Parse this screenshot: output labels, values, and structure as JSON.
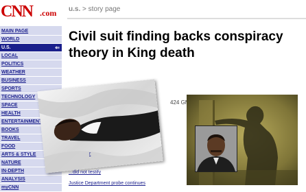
{
  "logo": {
    "text": "CNN",
    "suffix": ".com"
  },
  "nav": [
    {
      "label": "MAIN PAGE"
    },
    {
      "label": "WORLD"
    },
    {
      "label": "U.S.",
      "active": true
    },
    {
      "label": "LOCAL"
    },
    {
      "label": "POLITICS"
    },
    {
      "label": "WEATHER"
    },
    {
      "label": "BUSINESS"
    },
    {
      "label": "SPORTS"
    },
    {
      "label": "TECHNOLOGY"
    },
    {
      "label": "SPACE"
    },
    {
      "label": "HEALTH"
    },
    {
      "label": "ENTERTAINMENT"
    },
    {
      "label": "BOOKS"
    },
    {
      "label": "TRAVEL"
    },
    {
      "label": "FOOD"
    },
    {
      "label": "ARTS & STYLE"
    },
    {
      "label": "NATURE"
    },
    {
      "label": "IN-DEPTH"
    },
    {
      "label": "ANALYSIS"
    },
    {
      "label": "myCNN"
    }
  ],
  "nav_active_arrow": "⇐",
  "breadcrumb": {
    "section": "u.s.",
    "separator": ">",
    "page": "story page"
  },
  "headline": "Civil suit finding backs conspiracy theory in King death",
  "story_meta": "424 GMT)",
  "related": [
    "r",
    "...did not testify",
    "Justice Department probe continues"
  ],
  "colors": {
    "brand_red": "#cc0000",
    "nav_bg": "#d6d9ee",
    "nav_link": "#1a1f8c"
  }
}
